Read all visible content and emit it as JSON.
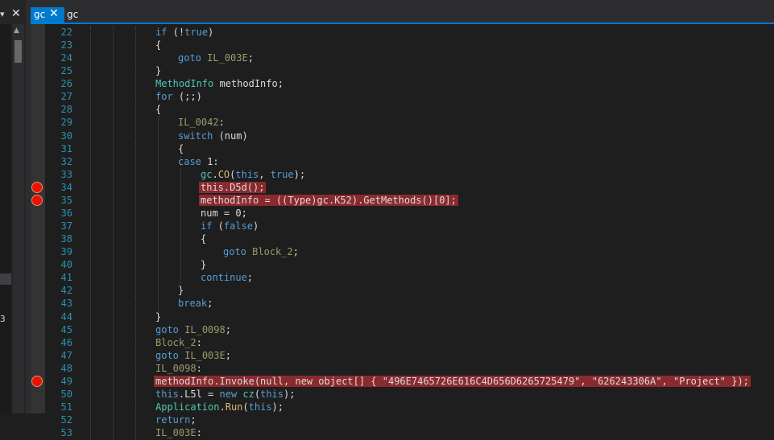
{
  "tabs": [
    {
      "label": "gc",
      "active": true,
      "close_glyph": "✕"
    },
    {
      "label": "gc",
      "active": false
    }
  ],
  "left_panel": {
    "dropdown_glyph": "▾",
    "close_glyph": "✕",
    "fragment_text": "3",
    "scroll_up_glyph": "▲"
  },
  "colors": {
    "accent": "#007acc",
    "breakpoint": "#e51400",
    "breakpoint_highlight": "#8a2a2e",
    "line_number": "#2b91af",
    "keyword": "#569cd6",
    "type": "#4ec9b0"
  },
  "code": {
    "lines": [
      {
        "no": "22",
        "tokens": [
          [
            "k",
            "if"
          ],
          [
            "p",
            " (!"
          ],
          [
            "k",
            "true"
          ],
          [
            "p",
            ")"
          ]
        ]
      },
      {
        "no": "23",
        "tokens": [
          [
            "p",
            "{"
          ]
        ]
      },
      {
        "no": "24",
        "tokens": [
          [
            "k",
            "goto"
          ],
          [
            "p",
            " "
          ],
          [
            "lb",
            "IL_003E"
          ],
          [
            "p",
            ";"
          ]
        ]
      },
      {
        "no": "25",
        "tokens": [
          [
            "p",
            "}"
          ]
        ]
      },
      {
        "no": "26",
        "tokens": [
          [
            "t",
            "MethodInfo"
          ],
          [
            "p",
            " methodInfo;"
          ]
        ]
      },
      {
        "no": "27",
        "tokens": [
          [
            "k",
            "for"
          ],
          [
            "p",
            " (;;)"
          ]
        ]
      },
      {
        "no": "28",
        "tokens": [
          [
            "p",
            "{"
          ]
        ]
      },
      {
        "no": "29",
        "tokens": [
          [
            "lb",
            "IL_0042"
          ],
          [
            "p",
            ":"
          ]
        ]
      },
      {
        "no": "30",
        "tokens": [
          [
            "k",
            "switch"
          ],
          [
            "p",
            " (num)"
          ]
        ]
      },
      {
        "no": "31",
        "tokens": [
          [
            "p",
            "{"
          ]
        ]
      },
      {
        "no": "32",
        "tokens": [
          [
            "k",
            "case"
          ],
          [
            "p",
            " 1:"
          ]
        ]
      },
      {
        "no": "33",
        "tokens": [
          [
            "t",
            "gc"
          ],
          [
            "p",
            "."
          ],
          [
            "m",
            "CO"
          ],
          [
            "p",
            "("
          ],
          [
            "k",
            "this"
          ],
          [
            "p",
            ", "
          ],
          [
            "k",
            "true"
          ],
          [
            "p",
            ");"
          ]
        ]
      },
      {
        "no": "34",
        "tokens": [
          [
            "p",
            "this.D5d();"
          ]
        ],
        "breakpoint": true
      },
      {
        "no": "35",
        "tokens": [
          [
            "p",
            "methodInfo = ((Type)gc.K52).GetMethods()[0];"
          ]
        ],
        "breakpoint": true
      },
      {
        "no": "36",
        "tokens": [
          [
            "p",
            "num = 0;"
          ]
        ]
      },
      {
        "no": "37",
        "tokens": [
          [
            "k",
            "if"
          ],
          [
            "p",
            " ("
          ],
          [
            "k",
            "false"
          ],
          [
            "p",
            ")"
          ]
        ]
      },
      {
        "no": "38",
        "tokens": [
          [
            "p",
            "{"
          ]
        ]
      },
      {
        "no": "39",
        "tokens": [
          [
            "k",
            "goto"
          ],
          [
            "p",
            " "
          ],
          [
            "lb",
            "Block_2"
          ],
          [
            "p",
            ";"
          ]
        ]
      },
      {
        "no": "40",
        "tokens": [
          [
            "p",
            "}"
          ]
        ]
      },
      {
        "no": "41",
        "tokens": [
          [
            "k",
            "continue"
          ],
          [
            "p",
            ";"
          ]
        ]
      },
      {
        "no": "42",
        "tokens": [
          [
            "p",
            "}"
          ]
        ]
      },
      {
        "no": "43",
        "tokens": [
          [
            "k",
            "break"
          ],
          [
            "p",
            ";"
          ]
        ]
      },
      {
        "no": "44",
        "tokens": [
          [
            "p",
            "}"
          ]
        ]
      },
      {
        "no": "45",
        "tokens": [
          [
            "k",
            "goto"
          ],
          [
            "p",
            " "
          ],
          [
            "lb",
            "IL_0098"
          ],
          [
            "p",
            ";"
          ]
        ]
      },
      {
        "no": "46",
        "tokens": [
          [
            "lb",
            "Block_2"
          ],
          [
            "p",
            ":"
          ]
        ]
      },
      {
        "no": "47",
        "tokens": [
          [
            "k",
            "goto"
          ],
          [
            "p",
            " "
          ],
          [
            "lb",
            "IL_003E"
          ],
          [
            "p",
            ";"
          ]
        ]
      },
      {
        "no": "48",
        "tokens": [
          [
            "lb",
            "IL_0098"
          ],
          [
            "p",
            ":"
          ]
        ]
      },
      {
        "no": "49",
        "tokens": [
          [
            "p",
            "methodInfo.Invoke(null, new object[] { \"496E7465726E616C4D656D6265725479\", \"626243306A\", \"Project\" });"
          ]
        ],
        "breakpoint": true
      },
      {
        "no": "50",
        "tokens": [
          [
            "k",
            "this"
          ],
          [
            "p",
            "."
          ],
          [
            "p",
            "L5l = "
          ],
          [
            "k",
            "new"
          ],
          [
            "p",
            " "
          ],
          [
            "t",
            "cz"
          ],
          [
            "p",
            "("
          ],
          [
            "k",
            "this"
          ],
          [
            "p",
            ");"
          ]
        ]
      },
      {
        "no": "51",
        "tokens": [
          [
            "t",
            "Application"
          ],
          [
            "p",
            "."
          ],
          [
            "m",
            "Run"
          ],
          [
            "p",
            "("
          ],
          [
            "k",
            "this"
          ],
          [
            "p",
            ");"
          ]
        ]
      },
      {
        "no": "52",
        "tokens": [
          [
            "k",
            "return"
          ],
          [
            "p",
            ";"
          ]
        ]
      },
      {
        "no": "53",
        "tokens": [
          [
            "lb",
            "IL_003E"
          ],
          [
            "p",
            ":"
          ]
        ]
      }
    ]
  }
}
